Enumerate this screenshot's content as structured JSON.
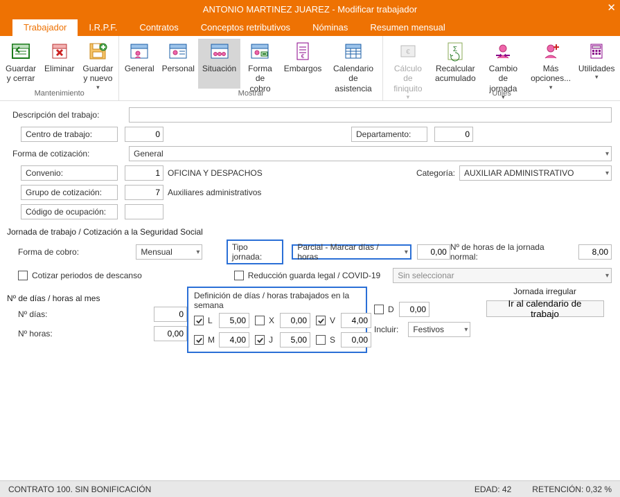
{
  "window": {
    "title": "ANTONIO MARTINEZ JUAREZ - Modificar trabajador"
  },
  "menu_tabs": {
    "trabajador": "Trabajador",
    "irpf": "I.R.P.F.",
    "contratos": "Contratos",
    "conceptos": "Conceptos retributivos",
    "nominas": "Nóminas",
    "resumen": "Resumen mensual"
  },
  "ribbon": {
    "groups": {
      "mant": "Mantenimiento",
      "mostrar": "Mostrar",
      "utiles": "Útiles"
    },
    "buttons": {
      "guardar_y_cerrar": "Guardar\ny cerrar",
      "eliminar": "Eliminar",
      "guardar_y_nuevo": "Guardar\ny nuevo",
      "general": "General",
      "personal": "Personal",
      "situacion": "Situación",
      "forma_de_cobro": "Forma\nde cobro",
      "embargos": "Embargos",
      "calendario_asistencia": "Calendario\nde asistencia",
      "calculo_finiquito": "Cálculo de\nfiniquito",
      "recalcular_acumulado": "Recalcular\nacumulado",
      "cambio_jornada": "Cambio de\njornada",
      "mas_opciones": "Más\nopciones...",
      "utilidades": "Utilidades"
    }
  },
  "form": {
    "descripcion_trabajo_label": "Descripción del trabajo:",
    "descripcion_trabajo_value": "",
    "centro_trabajo_label": "Centro de trabajo:",
    "centro_trabajo_value": "0",
    "departamento_label": "Departamento:",
    "departamento_value": "0",
    "forma_cotizacion_label": "Forma de cotización:",
    "forma_cotizacion_value": "General",
    "convenio_label": "Convenio:",
    "convenio_num": "1",
    "convenio_text": "OFICINA Y DESPACHOS",
    "categoria_label": "Categoría:",
    "categoria_value": "AUXILIAR ADMINISTRATIVO",
    "grupo_cotizacion_label": "Grupo de cotización:",
    "grupo_cotizacion_num": "7",
    "grupo_cotizacion_text": "Auxiliares administrativos",
    "codigo_ocupacion_label": "Código de ocupación:",
    "codigo_ocupacion_value": "",
    "jornada_section_title": "Jornada de trabajo / Cotización a la Seguridad Social",
    "forma_cobro_label": "Forma de cobro:",
    "forma_cobro_value": "Mensual",
    "tipo_jornada_label": "Tipo jornada:",
    "tipo_jornada_value": "Parcial - Marcar días / horas",
    "tipo_jornada_extra": "0,00",
    "horas_jornada_normal_label": "Nº de horas de la jornada normal:",
    "horas_jornada_normal_value": "8,00",
    "cotizar_periodos_label": "Cotizar periodos de descanso",
    "reduccion_guarda_label": "Reducción guarda legal / COVID-19",
    "sin_seleccionar": "Sin seleccionar",
    "dias_horas_mes_title": "Nº de días / horas al mes",
    "n_dias_label": "Nº días:",
    "n_dias_value": "0",
    "n_horas_label": "Nº horas:",
    "n_horas_value": "0,00",
    "definicion_semana_title": "Definición de días / horas trabajados en la semana",
    "days": {
      "L": {
        "label": "L",
        "value": "5,00",
        "checked": true
      },
      "M": {
        "label": "M",
        "value": "4,00",
        "checked": true
      },
      "X": {
        "label": "X",
        "value": "0,00",
        "checked": false
      },
      "J": {
        "label": "J",
        "value": "5,00",
        "checked": true
      },
      "V": {
        "label": "V",
        "value": "4,00",
        "checked": true
      },
      "S": {
        "label": "S",
        "value": "0,00",
        "checked": false
      },
      "D": {
        "label": "D",
        "value": "0,00",
        "checked": false
      }
    },
    "incluir_label": "Incluir:",
    "incluir_value": "Festivos",
    "jornada_irregular_title": "Jornada irregular",
    "ir_al_calendario": "Ir al calendario de trabajo"
  },
  "statusbar": {
    "contrato": "CONTRATO 100.  SIN BONIFICACIÓN",
    "edad_label": "EDAD:",
    "edad_value": "42",
    "retencion_label": "RETENCIÓN:",
    "retencion_value": "0,32 %"
  }
}
